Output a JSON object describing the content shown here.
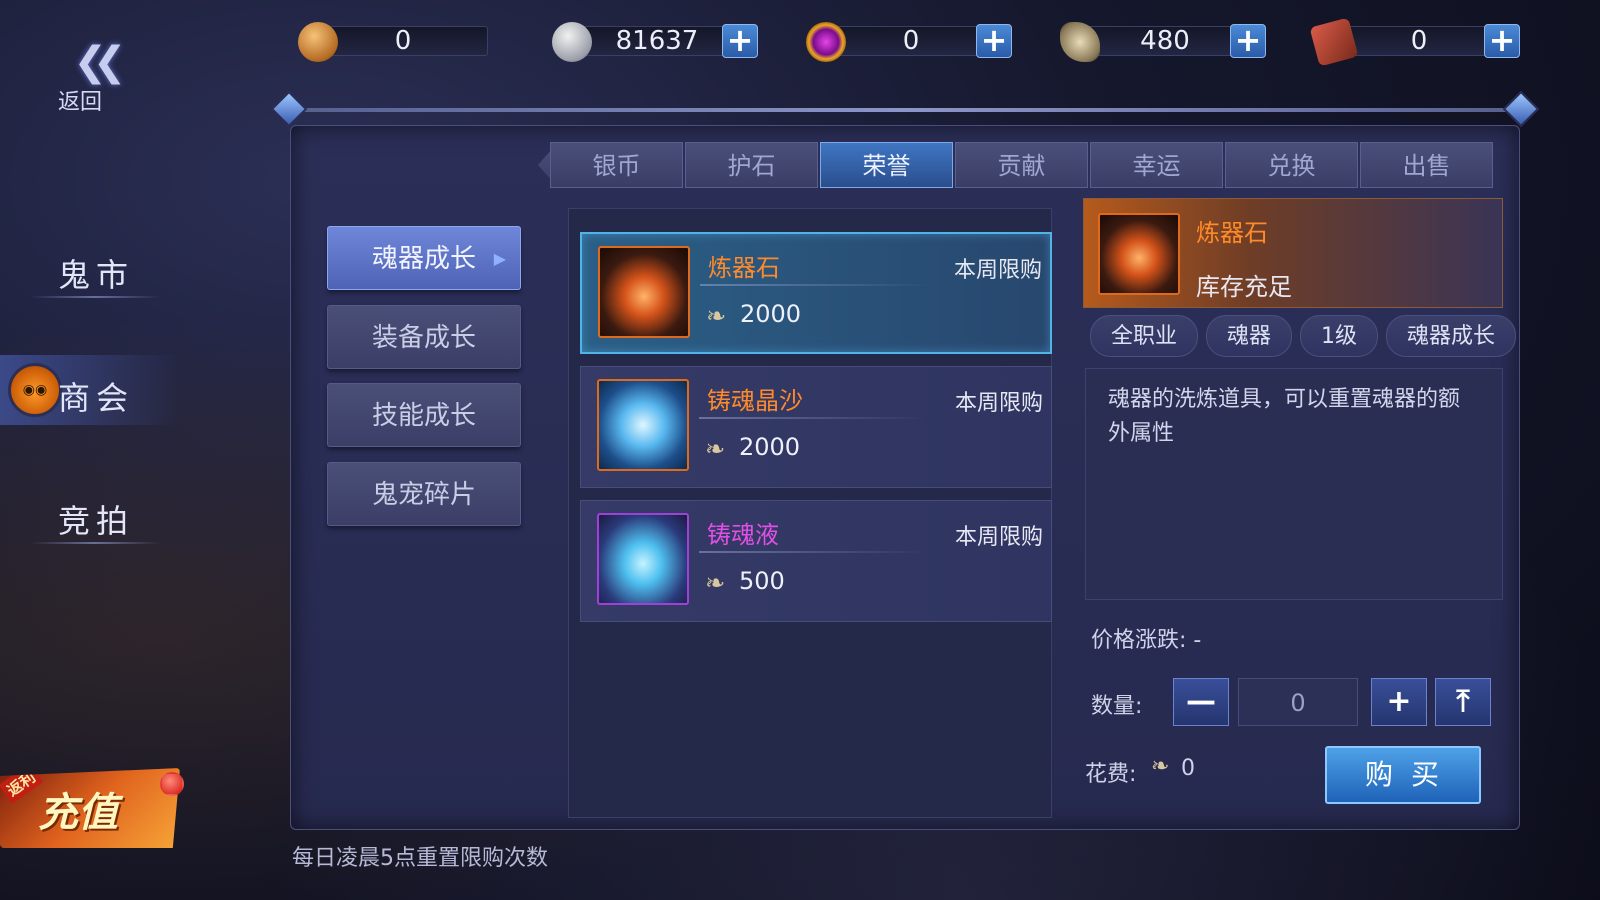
{
  "back": {
    "label": "返回"
  },
  "currencies": [
    {
      "icon": "copper-coin-icon",
      "value": "0",
      "has_plus": false
    },
    {
      "icon": "silver-coin-icon",
      "value": "81637",
      "has_plus": true
    },
    {
      "icon": "gem-icon",
      "value": "0",
      "has_plus": true
    },
    {
      "icon": "honor-horn-icon",
      "value": "480",
      "has_plus": true
    },
    {
      "icon": "token-icon",
      "value": "0",
      "has_plus": true
    }
  ],
  "side_menu": [
    {
      "label": "鬼市"
    },
    {
      "label": "商会",
      "active": true
    },
    {
      "label": "竞拍"
    }
  ],
  "recharge": {
    "label": "充值",
    "tag": "返利"
  },
  "tabs": [
    {
      "label": "银币"
    },
    {
      "label": "护石"
    },
    {
      "label": "荣誉",
      "active": true
    },
    {
      "label": "贡献"
    },
    {
      "label": "幸运"
    },
    {
      "label": "兑换"
    },
    {
      "label": "出售"
    }
  ],
  "categories": [
    {
      "label": "魂器成长",
      "active": true
    },
    {
      "label": "装备成长"
    },
    {
      "label": "技能成长"
    },
    {
      "label": "鬼宠碎片"
    }
  ],
  "items": [
    {
      "name": "炼器石",
      "name_color": "#ff8a2a",
      "limit": "本周限购",
      "price": "2000",
      "selected": true
    },
    {
      "name": "铸魂晶沙",
      "name_color": "#ff8a2a",
      "limit": "本周限购",
      "price": "2000"
    },
    {
      "name": "铸魂液",
      "name_color": "#e04fe6",
      "limit": "本周限购",
      "price": "500"
    }
  ],
  "detail": {
    "name": "炼器石",
    "stock": "库存充足",
    "tags": [
      "全职业",
      "魂器",
      "1级",
      "魂器成长"
    ],
    "description": "魂器的洗炼道具，可以重置魂器的额外属性",
    "price_change_label": "价格涨跌: -",
    "qty_label": "数量:",
    "qty_value": "0",
    "cost_label": "花费:",
    "cost_value": "0",
    "buy_label": "购买"
  },
  "footer": "每日凌晨5点重置限购次数"
}
